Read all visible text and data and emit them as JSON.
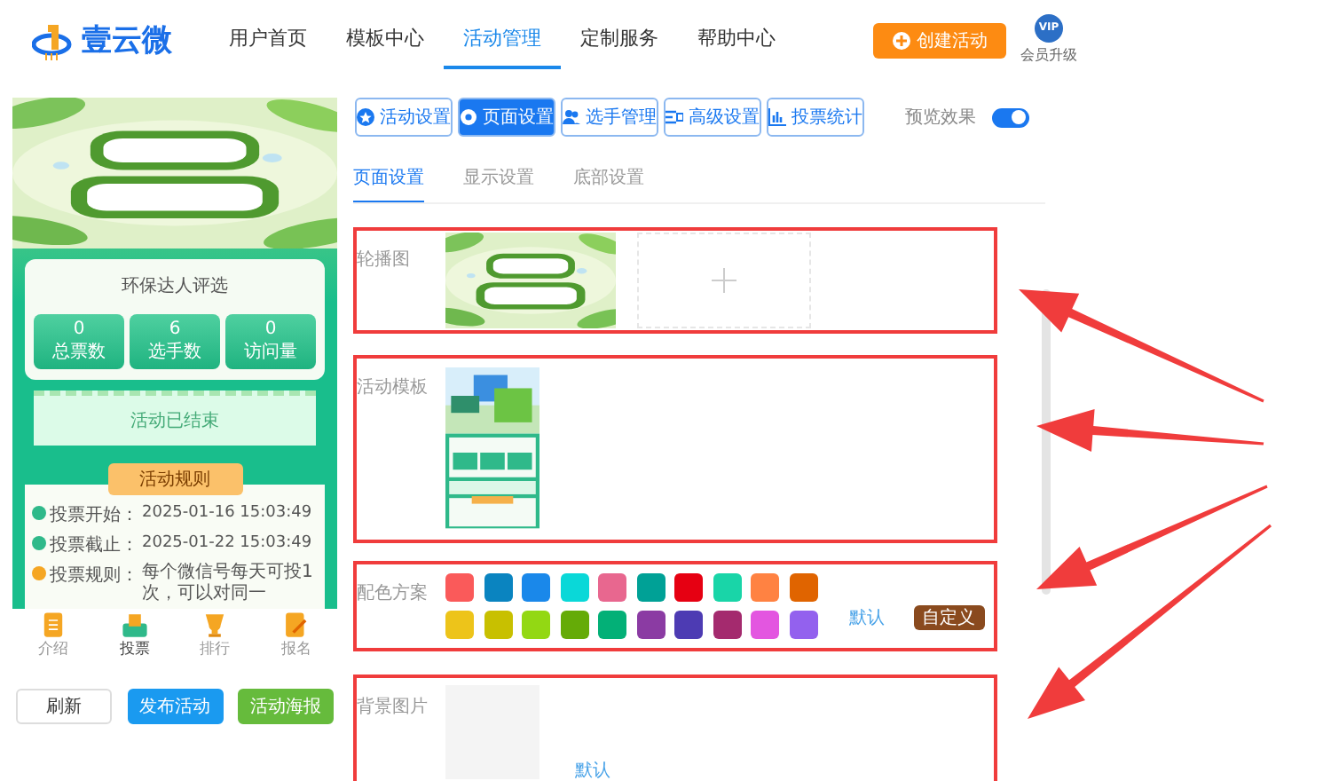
{
  "header": {
    "logo_text": "壹云微",
    "nav": [
      {
        "label": "用户首页",
        "selected": false
      },
      {
        "label": "模板中心",
        "selected": false
      },
      {
        "label": "活动管理",
        "selected": true
      },
      {
        "label": "定制服务",
        "selected": false
      },
      {
        "label": "帮助中心",
        "selected": false
      }
    ],
    "create_button": "创建活动",
    "vip_badge": "VIP",
    "vip_label": "会员升级"
  },
  "preview": {
    "title": "环保达人评选",
    "stats": [
      {
        "value": "0",
        "label": "总票数"
      },
      {
        "value": "6",
        "label": "选手数"
      },
      {
        "value": "0",
        "label": "访问量"
      }
    ],
    "status": "活动已结束",
    "rules_title": "活动规则",
    "rules": [
      {
        "kind": "time",
        "label": "投票开始：",
        "value": "2025-01-16 15:03:49"
      },
      {
        "kind": "time",
        "label": "投票截止：",
        "value": "2025-01-22 15:03:49"
      },
      {
        "kind": "info",
        "label": "投票规则：",
        "value": "每个微信号每天可投1次，可以对同一"
      }
    ],
    "bottom_nav": [
      {
        "label": "介绍",
        "kind": "intro",
        "selected": false
      },
      {
        "label": "投票",
        "kind": "vote",
        "selected": true
      },
      {
        "label": "排行",
        "kind": "ranking",
        "selected": false
      },
      {
        "label": "报名",
        "kind": "signup",
        "selected": false
      }
    ]
  },
  "actions": [
    {
      "label": "刷新",
      "kind": "plain"
    },
    {
      "label": "发布活动",
      "kind": "primary"
    },
    {
      "label": "活动海报",
      "kind": "success"
    }
  ],
  "toolbar": {
    "buttons": [
      {
        "label": "活动设置",
        "kind": "activity",
        "selected": false
      },
      {
        "label": "页面设置",
        "kind": "page",
        "selected": true
      },
      {
        "label": "选手管理",
        "kind": "players",
        "selected": false
      },
      {
        "label": "高级设置",
        "kind": "advanced",
        "selected": false
      },
      {
        "label": "投票统计",
        "kind": "stats",
        "selected": false
      }
    ],
    "preview_label": "预览效果",
    "preview_on": true
  },
  "subtabs": [
    {
      "label": "页面设置",
      "selected": true
    },
    {
      "label": "显示设置",
      "selected": false
    },
    {
      "label": "底部设置",
      "selected": false
    }
  ],
  "sections": [
    {
      "kind": "carousel",
      "label": "轮播图",
      "highlighted": true
    },
    {
      "kind": "template",
      "label": "活动模板",
      "highlighted": true
    },
    {
      "kind": "colors",
      "label": "配色方案",
      "highlighted": true,
      "default_link": "默认",
      "custom_button": "自定义",
      "swatches": [
        {
          "color": "#fa5a5a"
        },
        {
          "color": "#0a84c0"
        },
        {
          "color": "#1a88ea"
        },
        {
          "color": "#0ad8d8"
        },
        {
          "color": "#e8678f"
        },
        {
          "color": "#00a196"
        },
        {
          "color": "#e60012"
        },
        {
          "color": "#19d5a8"
        },
        {
          "color": "#ff8242"
        },
        {
          "color": "#e06400"
        },
        {
          "color": "#edc41a"
        },
        {
          "color": "#c8c000"
        },
        {
          "color": "#93d813"
        },
        {
          "color": "#65ab07"
        },
        {
          "color": "#03b077"
        },
        {
          "color": "#8b3ba3"
        },
        {
          "color": "#4d3bb3"
        },
        {
          "color": "#a42a6e"
        },
        {
          "color": "#e356e0"
        },
        {
          "color": "#9361ee"
        }
      ]
    },
    {
      "kind": "background",
      "label": "背景图片",
      "highlighted": true,
      "default_link": "默认"
    }
  ]
}
